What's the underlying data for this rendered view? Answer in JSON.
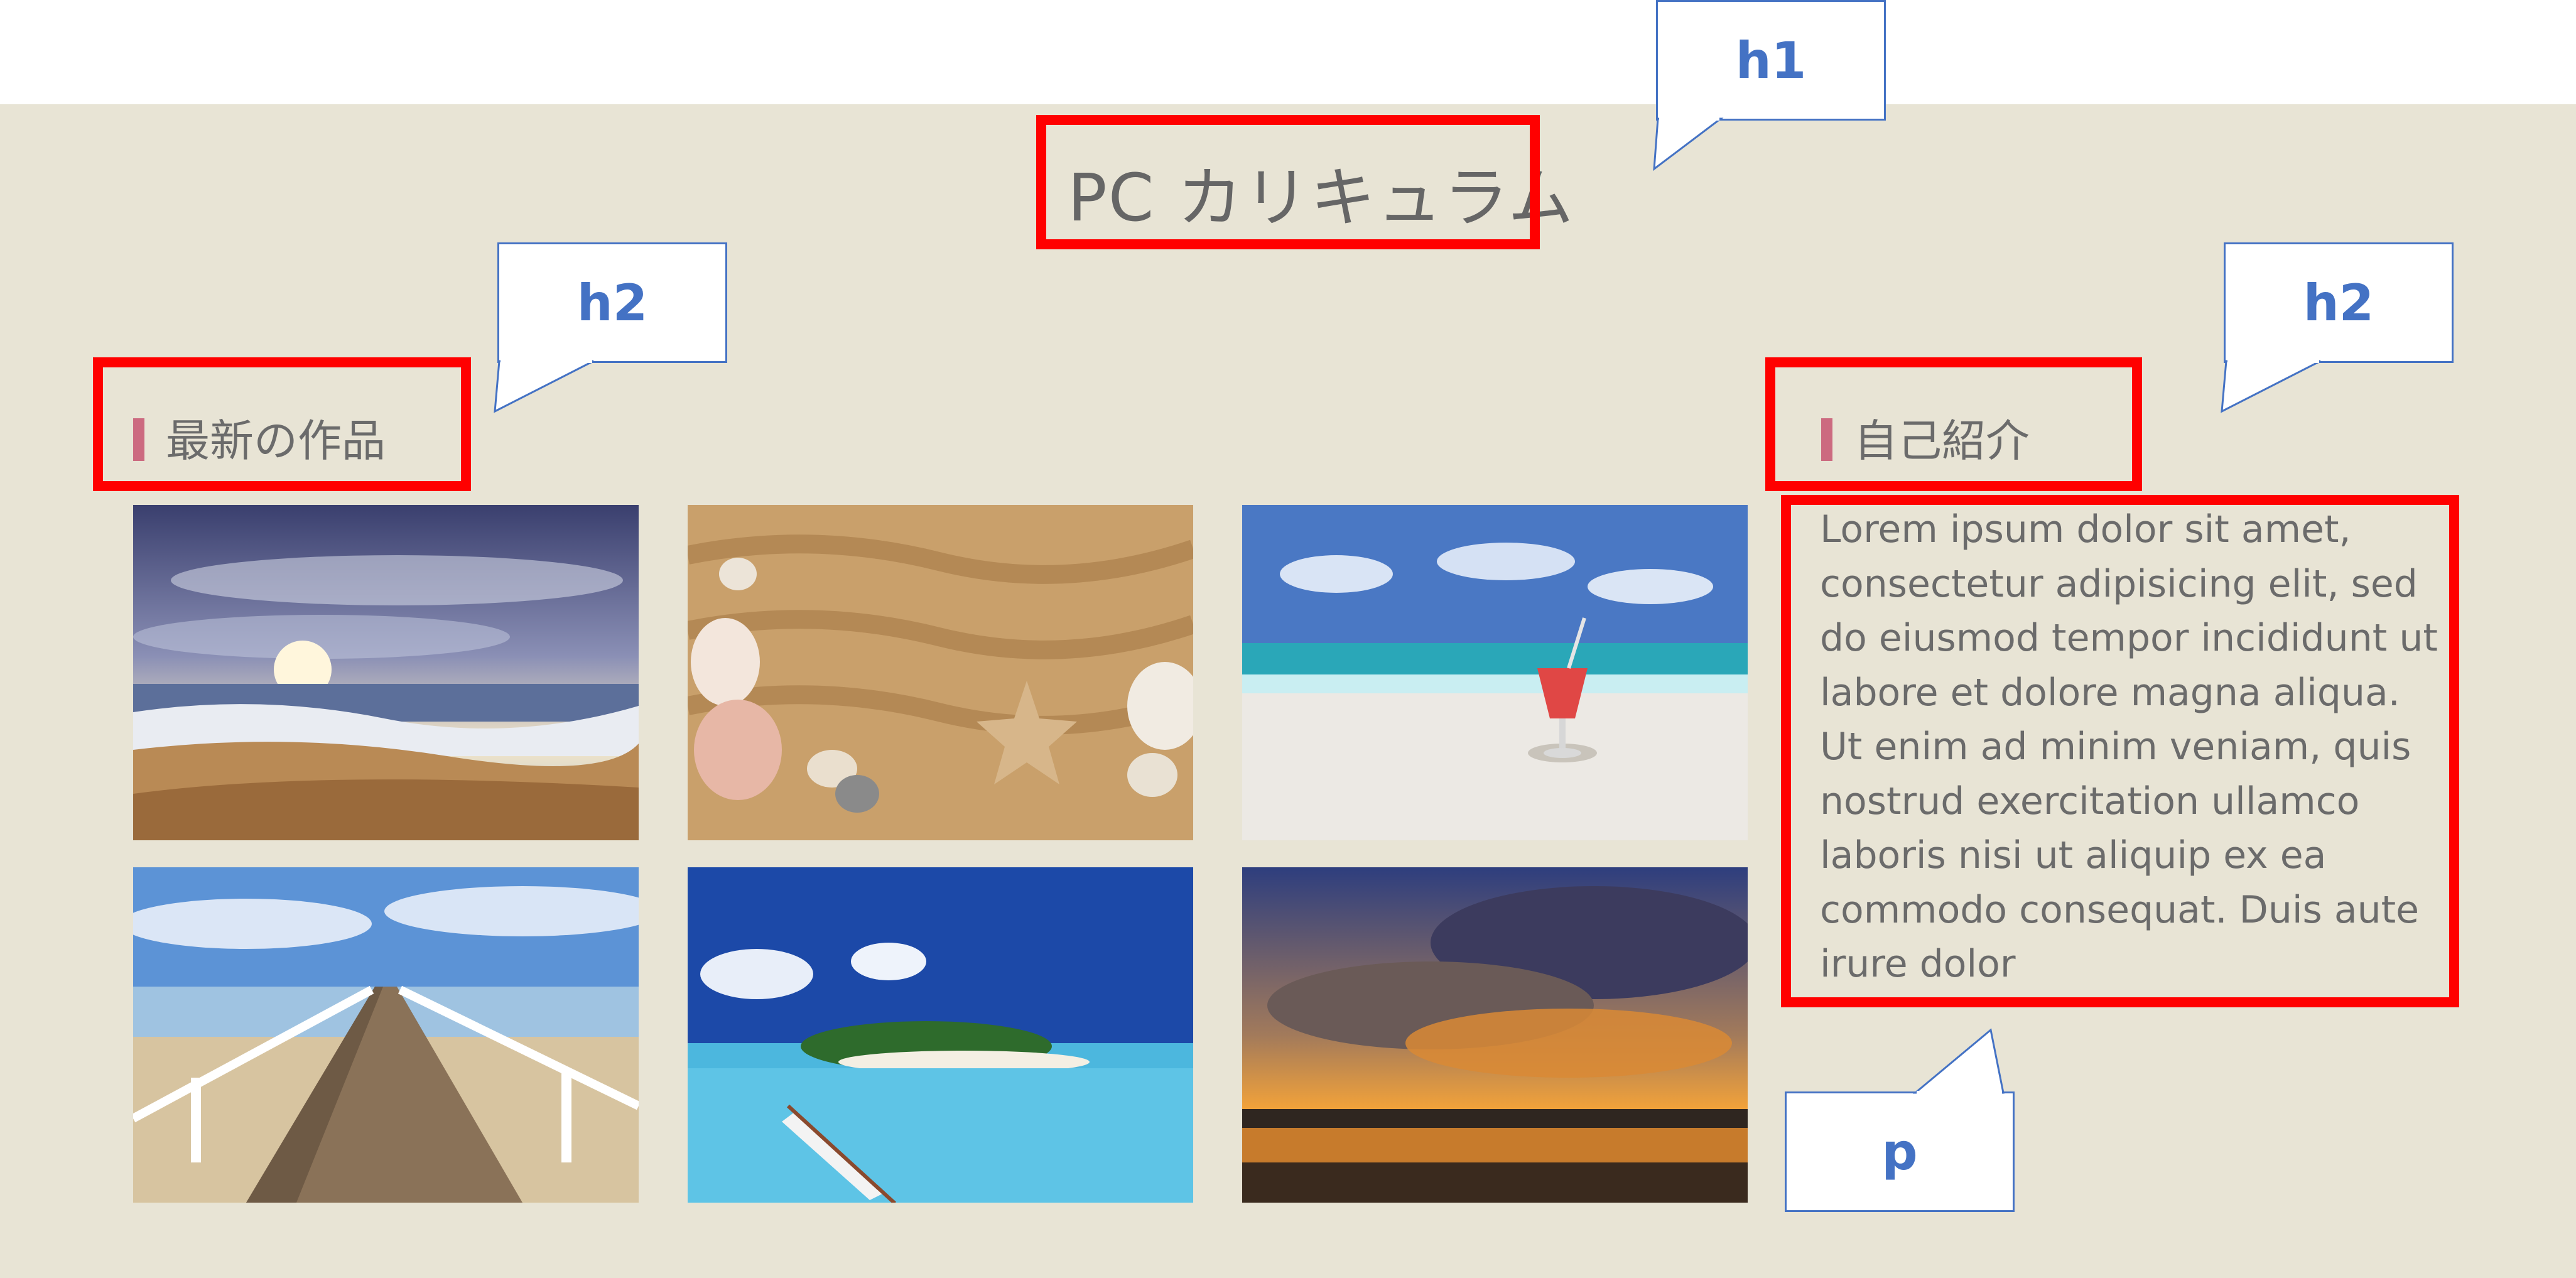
{
  "page_title": "PC カリキュラム",
  "sections": {
    "works_heading": "最新の作品",
    "profile_heading": "自己紹介",
    "profile_text": "Lorem ipsum dolor sit amet, consectetur adipisicing elit, sed do eiusmod tempor incididunt ut labore et dolore magna aliqua. Ut enim ad minim veniam, quis nostrud exercitation ullamco laboris nisi ut aliquip ex ea commodo consequat. Duis aute irure dolor"
  },
  "gallery": [
    {
      "subject": "sunset-beach-waves-photo"
    },
    {
      "subject": "seashells-starfish-sand-photo"
    },
    {
      "subject": "cocktail-on-beach-photo"
    },
    {
      "subject": "pier-boardwalk-photo"
    },
    {
      "subject": "tropical-island-canoe-photo"
    },
    {
      "subject": "dramatic-sunset-clouds-photo"
    }
  ],
  "annotations": {
    "h1_tag": "h1",
    "h2_works_tag": "h2",
    "h2_profile_tag": "h2",
    "p_tag": "p"
  },
  "colors": {
    "background": "#e8e4d5",
    "heading_accent": "#cc6a80",
    "highlight_box": "#ff0000",
    "callout_text": "#4472c4"
  }
}
